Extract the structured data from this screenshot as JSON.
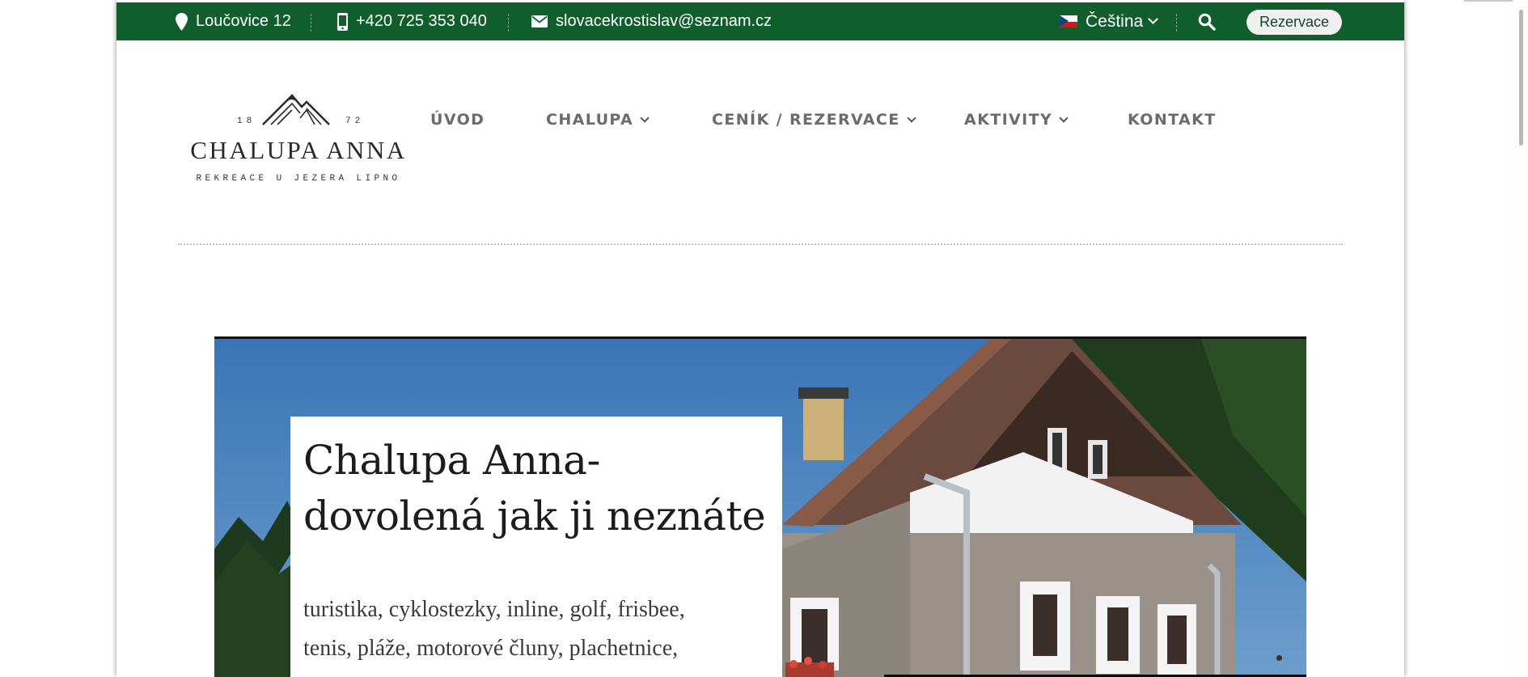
{
  "topbar": {
    "address": "Loučovice 12",
    "phone": "+420 725 353 040",
    "email": "slovacekrostislav@seznam.cz",
    "language": "Čeština",
    "reservation_button": "Rezervace",
    "bg_color": "#115e2d"
  },
  "logo": {
    "year_left": "18",
    "year_right": "72",
    "name": "CHALUPA ANNA",
    "subtitle": "REKREACE U JEZERA LIPNO"
  },
  "nav": {
    "items": [
      {
        "label": "ÚVOD",
        "dropdown": false
      },
      {
        "label": "CHALUPA",
        "dropdown": true
      },
      {
        "label": "CENÍK / REZERVACE",
        "dropdown": true
      },
      {
        "label": "AKTIVITY",
        "dropdown": true
      },
      {
        "label": "KONTAKT",
        "dropdown": false
      }
    ]
  },
  "hero": {
    "title_line1": "Chalupa Anna-",
    "title_line2": "dovolená jak ji neznáte",
    "text_line1": "turistika, cyklostezky, inline, golf, frisbee,",
    "text_line2": "tenis, pláže, motorové čluny, plachetnice,"
  },
  "icons": {
    "address": "map-marker-icon",
    "phone": "mobile-phone-icon",
    "email": "envelope-icon",
    "language": "czech-flag-icon",
    "search": "search-icon"
  }
}
